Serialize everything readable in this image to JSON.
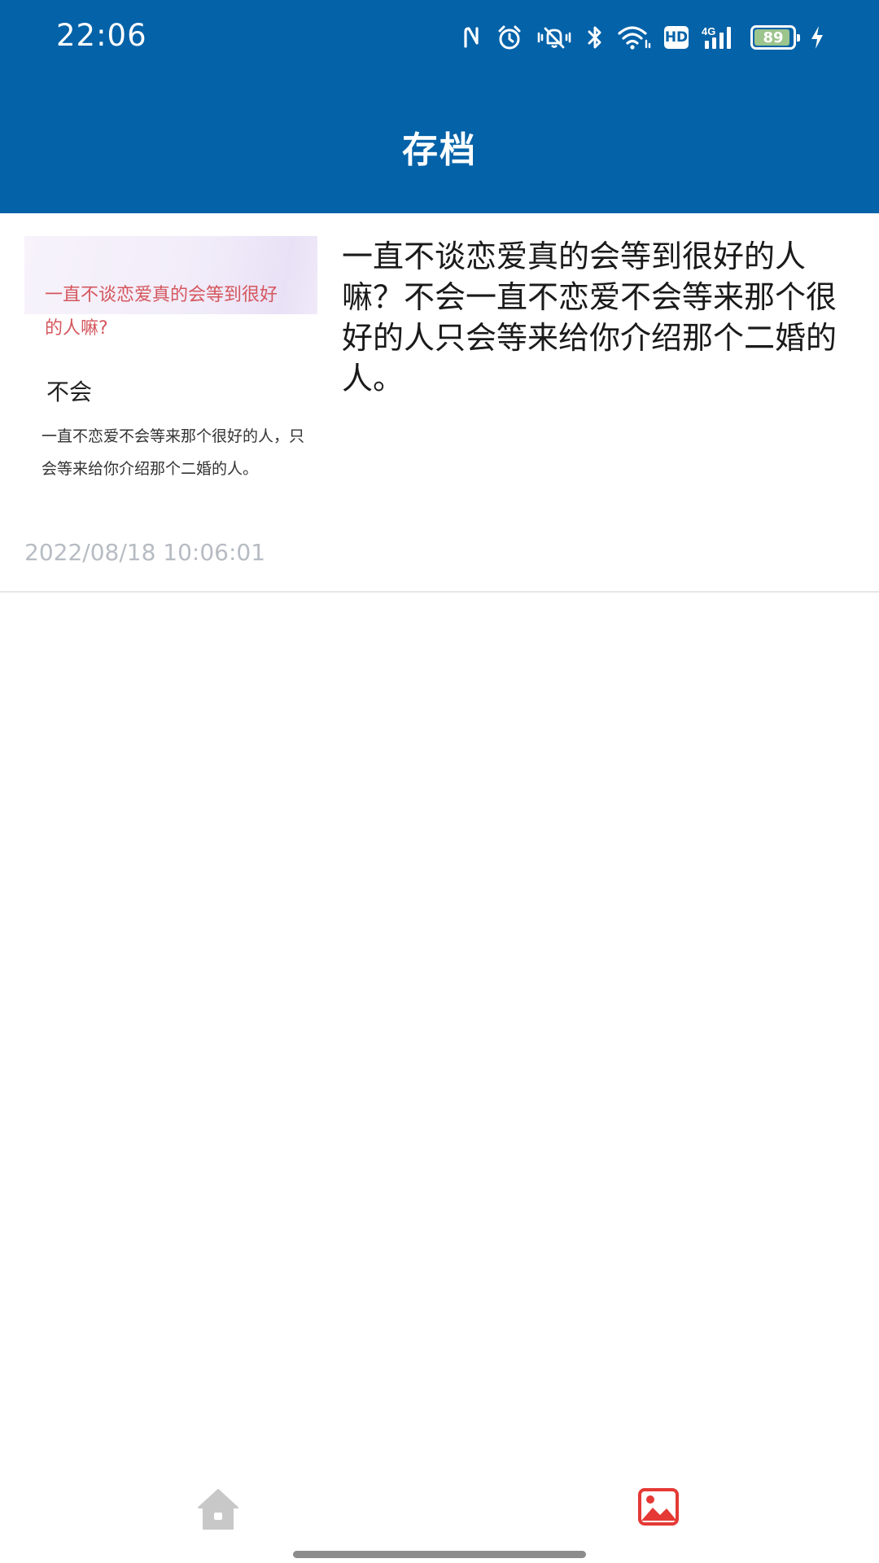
{
  "status_bar": {
    "time": "22:06",
    "battery_level": "89",
    "hd_label": "HD",
    "network_label": "4G"
  },
  "header": {
    "title": "存档"
  },
  "archive": {
    "items": [
      {
        "thumbnail": {
          "question": "一直不谈恋爱真的会等到很好的人嘛?",
          "answer": "不会",
          "detail": "一直不恋爱不会等来那个很好的人，只会等来给你介绍那个二婚的人。"
        },
        "text": "一直不谈恋爱真的会等到很好的人嘛？不会一直不恋爱不会等来那个很好的人只会等来给你介绍那个二婚的人。",
        "date": "2022/08/18 10:06:01"
      }
    ]
  },
  "bottom_nav": {
    "items": [
      {
        "icon": "home-icon",
        "active": false
      },
      {
        "icon": "gallery-icon",
        "active": true
      }
    ]
  },
  "colors": {
    "header_bg": "#0362a8",
    "active_nav": "#e53935",
    "inactive_nav": "#c8c8c8",
    "date_text": "#b7bcc3",
    "thumb_question": "#d5565d"
  }
}
